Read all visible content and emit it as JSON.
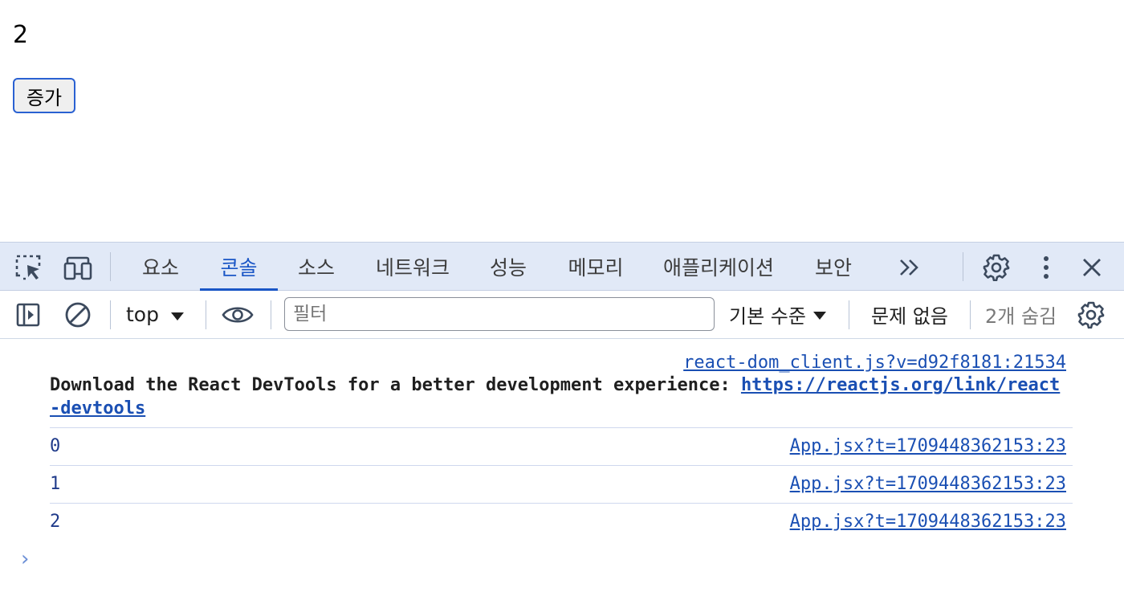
{
  "page": {
    "count": "2",
    "button_label": "증가"
  },
  "devtools": {
    "tabs": [
      {
        "label": "요소"
      },
      {
        "label": "콘솔"
      },
      {
        "label": "소스"
      },
      {
        "label": "네트워크"
      },
      {
        "label": "성능"
      },
      {
        "label": "메모리"
      },
      {
        "label": "애플리케이션"
      },
      {
        "label": "보안"
      }
    ],
    "active_tab": "콘솔",
    "more_tabs": "»",
    "toolbar": {
      "context": "top",
      "filter_placeholder": "필터",
      "filter_value": "",
      "level": "기본 수준",
      "issues": "문제 없음",
      "hidden": "2개 숨김"
    },
    "messages": [
      {
        "source": "react-dom_client.js?v=d92f8181:21534",
        "text": "Download the React DevTools for a better development experience: ",
        "link": "https://reactjs.org/link/react-devtools"
      },
      {
        "value": "0",
        "source": "App.jsx?t=1709448362153:23"
      },
      {
        "value": "1",
        "source": "App.jsx?t=1709448362153:23"
      },
      {
        "value": "2",
        "source": "App.jsx?t=1709448362153:23"
      }
    ],
    "prompt": "›"
  },
  "colors": {
    "accent": "#1a56c6",
    "tabbar_bg": "#e1e9f7",
    "link": "#1a4fb3",
    "button_border": "#2a61d2"
  }
}
